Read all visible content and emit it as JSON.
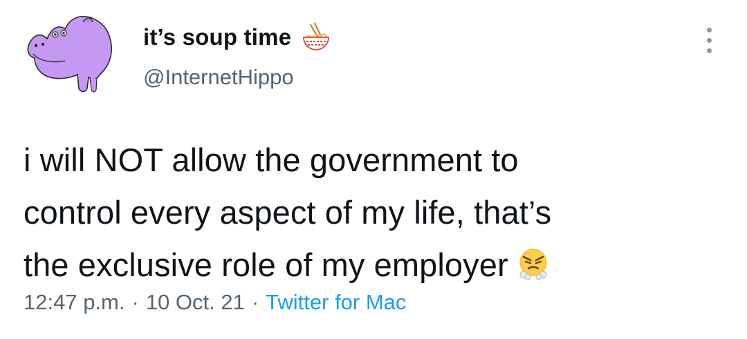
{
  "user": {
    "display_name": "it’s soup time",
    "handle": "@InternetHippo",
    "avatar_icon": "purple-hippo-avatar",
    "name_emoji": "ramen-bowl-icon"
  },
  "tweet": {
    "lines": [
      "i will NOT allow the government to",
      "control every aspect of my life, that’s",
      "the exclusive role of my employer"
    ],
    "trailing_emoji": "angry-huffing-face-icon"
  },
  "meta": {
    "time": "12:47 p.m.",
    "separator": "·",
    "date": "10 Oct. 21",
    "source": "Twitter for Mac"
  },
  "colors": {
    "text": "#0f1419",
    "secondary": "#536471",
    "link": "#1d9bf0",
    "avatar_fill": "#c599f2"
  }
}
